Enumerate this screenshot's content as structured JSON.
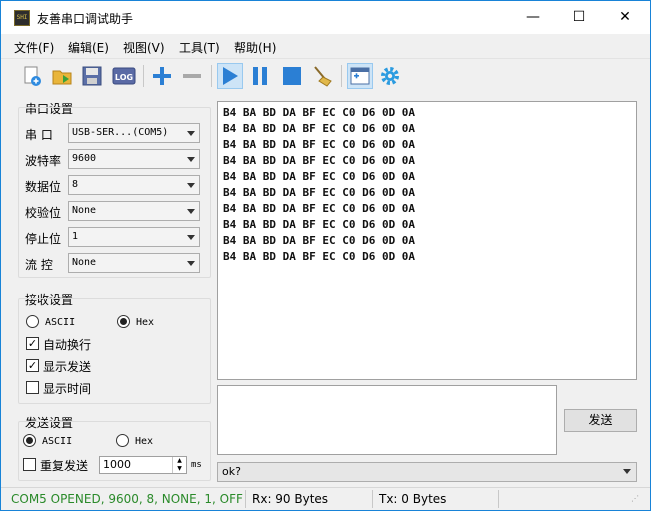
{
  "window": {
    "title": "友善串口调试助手",
    "minimize": "—",
    "maximize": "☐",
    "close": "✕",
    "app_icon_text": "SHI"
  },
  "menu": [
    "文件(F)",
    "编辑(E)",
    "视图(V)",
    "工具(T)",
    "帮助(H)"
  ],
  "toolbar": {
    "log_label": "LOG"
  },
  "serial": {
    "group": "串口设置",
    "port_label": "串 口",
    "port_value": "USB-SER...(COM5)",
    "baud_label": "波特率",
    "baud_value": "9600",
    "data_label": "数据位",
    "data_value": "8",
    "parity_label": "校验位",
    "parity_value": "None",
    "stop_label": "停止位",
    "stop_value": "1",
    "flow_label": "流 控",
    "flow_value": "None"
  },
  "receive": {
    "group": "接收设置",
    "ascii": "ASCII",
    "hex": "Hex",
    "selected": "Hex",
    "auto_wrap": "自动换行",
    "auto_wrap_checked": true,
    "show_send": "显示发送",
    "show_send_checked": true,
    "show_time": "显示时间",
    "show_time_checked": false
  },
  "send": {
    "group": "发送设置",
    "ascii": "ASCII",
    "hex": "Hex",
    "selected": "ASCII",
    "repeat": "重复发送",
    "repeat_checked": false,
    "interval": "1000",
    "unit": "ms",
    "button": "发送"
  },
  "rx_lines": [
    "B4 BA BD DA BF EC C0 D6 0D 0A",
    "B4 BA BD DA BF EC C0 D6 0D 0A",
    "B4 BA BD DA BF EC C0 D6 0D 0A",
    "B4 BA BD DA BF EC C0 D6 0D 0A",
    "B4 BA BD DA BF EC C0 D6 0D 0A",
    "B4 BA BD DA BF EC C0 D6 0D 0A",
    "B4 BA BD DA BF EC C0 D6 0D 0A",
    "B4 BA BD DA BF EC C0 D6 0D 0A",
    "B4 BA BD DA BF EC C0 D6 0D 0A",
    "B4 BA BD DA BF EC C0 D6 0D 0A"
  ],
  "history_value": "ok?",
  "status": {
    "connection": "COM5 OPENED, 9600, 8, NONE, 1, OFF",
    "connection_color": "#2a8a2a",
    "rx": "Rx: 90 Bytes",
    "tx": "Tx: 0 Bytes"
  }
}
